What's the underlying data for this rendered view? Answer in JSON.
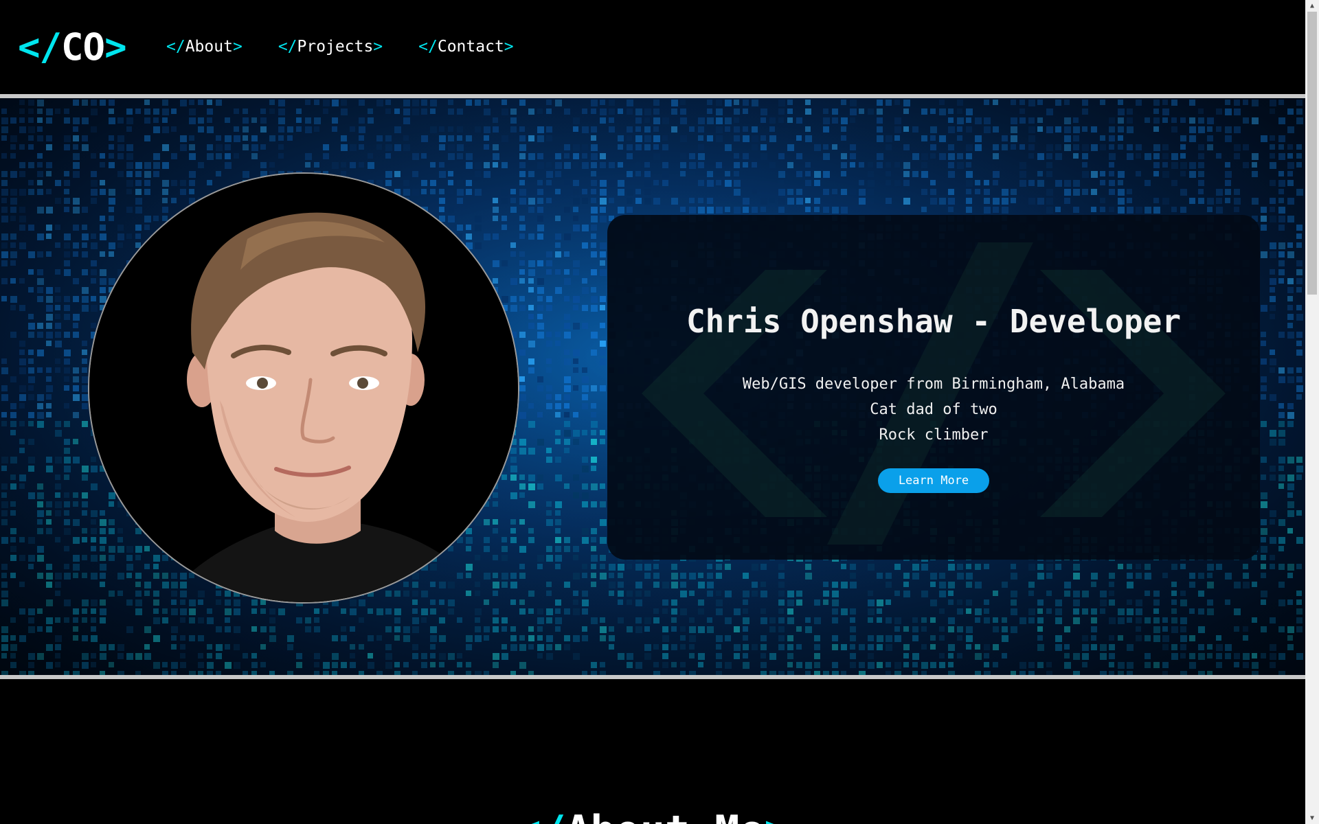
{
  "nav": {
    "logo": {
      "open": "</",
      "text": "CO",
      "close": ">"
    },
    "links": [
      {
        "open": "</",
        "label": "About",
        "close": ">"
      },
      {
        "open": "</",
        "label": "Projects",
        "close": ">"
      },
      {
        "open": "</",
        "label": "Contact",
        "close": ">"
      }
    ]
  },
  "hero": {
    "title": "Chris Openshaw - Developer",
    "lines": [
      "Web/GIS developer from Birmingham, Alabama",
      "Cat dad of two",
      "Rock climber"
    ],
    "button_label": "Learn More",
    "photo_icon": "profile-photo"
  },
  "about": {
    "open": "</",
    "title": "About Me",
    "close": ">"
  },
  "colors": {
    "accent": "#00e5ee",
    "button": "#0aa0ea",
    "background": "#000000"
  },
  "scrollbar": {
    "up_icon": "scroll-up-arrow-icon",
    "down_icon": "scroll-down-arrow-icon"
  }
}
